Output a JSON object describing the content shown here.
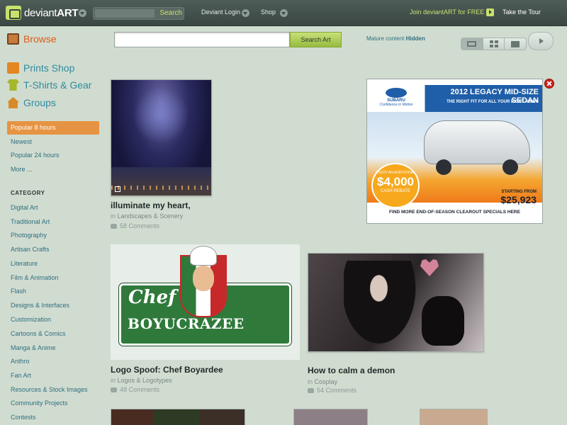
{
  "topbar": {
    "brand_bold": "deviant",
    "brand_rest": "ART",
    "search_button": "Search",
    "deviant_login": "Deviant Login",
    "shop": "Shop",
    "join": "Join deviantART for FREE",
    "tour": "Take the Tour"
  },
  "sidebar": {
    "browse": "Browse",
    "prints_shop": "Prints Shop",
    "tshirts": "T-Shirts & Gear",
    "groups": "Groups",
    "sort": [
      "Popular 8 hours",
      "Newest",
      "Popular 24 hours",
      "More ..."
    ],
    "category_heading": "CATEGORY",
    "categories": [
      "Digital Art",
      "Traditional Art",
      "Photography",
      "Artisan Crafts",
      "Literature",
      "Film & Animation",
      "Flash",
      "Designs & Interfaces",
      "Customization",
      "Cartoons & Comics",
      "Manga & Anime",
      "Anthro",
      "Fan Art",
      "Resources & Stock Images",
      "Community Projects",
      "Contests"
    ]
  },
  "search": {
    "placeholder": "",
    "button": "Search Art",
    "mature_label": "Mature content",
    "mature_value": "Hidden"
  },
  "thumbs": [
    {
      "title": "illuminate my heart,",
      "in": "in",
      "category": "Landscapes & Scenery",
      "comments": "58 Comments"
    },
    {
      "title": "Logo Spoof: Chef Boyardee",
      "in": "in",
      "category": "Logos & Logotypes",
      "comments": "48 Comments"
    },
    {
      "title": "How to calm a demon",
      "in": "in",
      "category": "Cosplay",
      "comments": "54 Comments"
    }
  ],
  "chef_logo": {
    "word1": "Chef",
    "word2": "BOYUCRAZEE"
  },
  "ad": {
    "brand": "SUBARU",
    "tagline": "Confidence in Motion",
    "title": "2012 LEGACY MID-SIZE SEDAN",
    "subtitle": "THE RIGHT FIT FOR ALL YOUR RIGHT NOWS",
    "cash_l1": "ENJOY AN ADDITIONAL",
    "cash_amount": "$4,000",
    "cash_l2": "CASH REBATE",
    "price_l1": "STARTING FROM",
    "price": "$25,923",
    "footer": "FIND MORE END-OF-SEASON CLEAROUT SPECIALS HERE"
  },
  "colors": {
    "background": "#d1dcd0",
    "topbar": "#3a4642",
    "accent_green": "#c8e16d",
    "active_orange": "#e69443",
    "link": "#2e6f80"
  }
}
